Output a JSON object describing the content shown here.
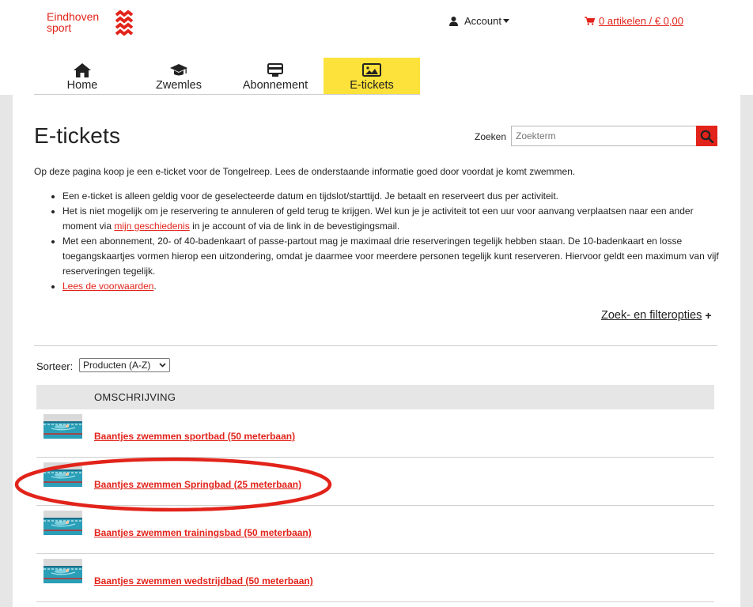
{
  "brand": {
    "logo_line1": "Eindhoven",
    "logo_line2": "sport",
    "color": "#e2231a"
  },
  "header": {
    "account_label": "Account",
    "cart_label": "0 artikelen / € 0,00"
  },
  "nav": {
    "items": [
      {
        "label": "Home",
        "icon": "home-icon"
      },
      {
        "label": "Zwemles",
        "icon": "graduation-cap-icon"
      },
      {
        "label": "Abonnement",
        "icon": "card-icon"
      },
      {
        "label": "E-tickets",
        "icon": "image-icon",
        "active": true
      }
    ],
    "active_color": "#fce23a"
  },
  "page": {
    "title": "E-tickets",
    "search_label": "Zoeken",
    "search_placeholder": "Zoekterm",
    "intro": "Op deze pagina koop je een e-ticket voor de Tongelreep.  Lees de onderstaande informatie goed door voordat je komt zwemmen.",
    "bullets": {
      "b1": "Een e-ticket is alleen geldig voor de geselecteerde datum en tijdslot/starttijd. Je betaalt en reserveert dus per activiteit.",
      "b2_pre": "Het is niet mogelijk om je reservering te annuleren of geld terug te krijgen. Wel kun je je activiteit tot een uur voor aanvang verplaatsen naar een ander moment via ",
      "b2_link": "mijn geschiedenis",
      "b2_post": " in je account of via de link in de bevestigingsmail.",
      "b3": "Met een abonnement, 20- of 40-badenkaart of passe-partout mag je maximaal drie reserveringen tegelijk hebben staan. De 10-badenkaart en losse toegangskaartjes vormen hierop een uitzondering, omdat je daarmee voor meerdere personen tegelijk kunt reserveren. Hiervoor geldt een maximum van vijf reserveringen tegelijk.",
      "b4_link": "Lees de voorwaarden",
      "b4_post": "."
    },
    "filter_label": "Zoek- en filteropties",
    "filter_plus": "+",
    "sort_label": "Sorteer:",
    "sort_value": "Producten (A-Z)"
  },
  "table": {
    "column": "OMSCHRIJVING",
    "rows": [
      {
        "label": "Baantjes zwemmen sportbad (50 meterbaan)"
      },
      {
        "label": "Baantjes zwemmen Springbad (25 meterbaan)",
        "highlighted": true
      },
      {
        "label": "Baantjes zwemmen trainingsbad (50 meterbaan)"
      },
      {
        "label": "Baantjes zwemmen wedstrijdbad (50 meterbaan)"
      }
    ]
  },
  "annotation_color": "#e2231a"
}
